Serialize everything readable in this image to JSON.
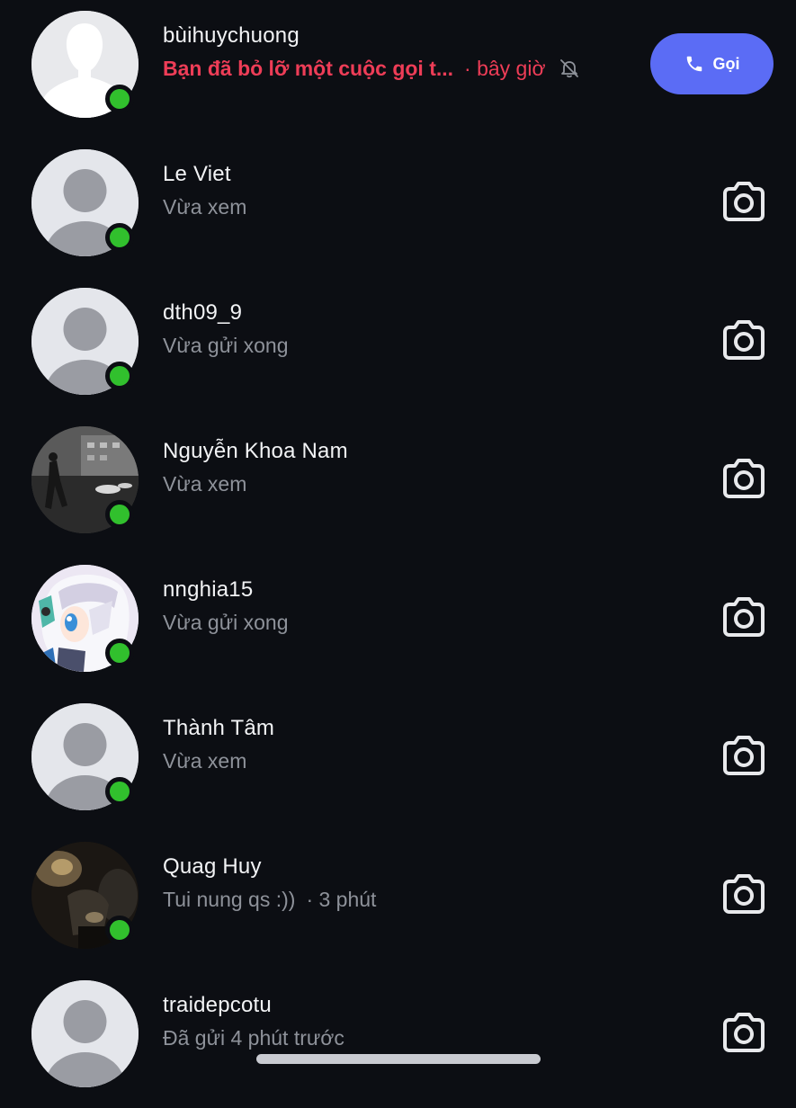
{
  "colors": {
    "background": "#0c0e13",
    "accent": "#5b6cf5",
    "missed": "#ee3d57",
    "online": "#31c02d",
    "subtext": "#8e929a"
  },
  "conversations": [
    {
      "name": "bùihuychuong",
      "status": "Bạn đã bỏ lỡ một cuộc gọi t...",
      "time": "· bây giờ",
      "missed_call": true,
      "muted": true,
      "online": true,
      "avatar": "default-silhouette",
      "action": {
        "type": "call",
        "label": "Gọi",
        "icon": "phone-icon"
      }
    },
    {
      "name": "Le Viet",
      "status": "Vừa xem",
      "online": true,
      "avatar": "default-person",
      "action": {
        "type": "camera",
        "icon": "camera-icon"
      }
    },
    {
      "name": "dth09_9",
      "status": "Vừa gửi xong",
      "online": true,
      "avatar": "default-person",
      "action": {
        "type": "camera",
        "icon": "camera-icon"
      }
    },
    {
      "name": "Nguyễn Khoa Nam",
      "status": "Vừa xem",
      "online": true,
      "avatar": "photo-street-night",
      "action": {
        "type": "camera",
        "icon": "camera-icon"
      }
    },
    {
      "name": "nnghia15",
      "status": "Vừa gửi xong",
      "online": true,
      "avatar": "photo-anime-character",
      "action": {
        "type": "camera",
        "icon": "camera-icon"
      }
    },
    {
      "name": "Thành Tâm",
      "status": "Vừa xem",
      "online": true,
      "avatar": "default-person",
      "action": {
        "type": "camera",
        "icon": "camera-icon"
      }
    },
    {
      "name": "Quag Huy",
      "status": "Tui nung qs :))",
      "time": "· 3 phút",
      "online": true,
      "avatar": "photo-dark-room",
      "action": {
        "type": "camera",
        "icon": "camera-icon"
      }
    },
    {
      "name": "traidepcotu",
      "status": "Đã gửi 4 phút trước",
      "online": false,
      "avatar": "default-person",
      "action": {
        "type": "camera",
        "icon": "camera-icon"
      }
    }
  ]
}
